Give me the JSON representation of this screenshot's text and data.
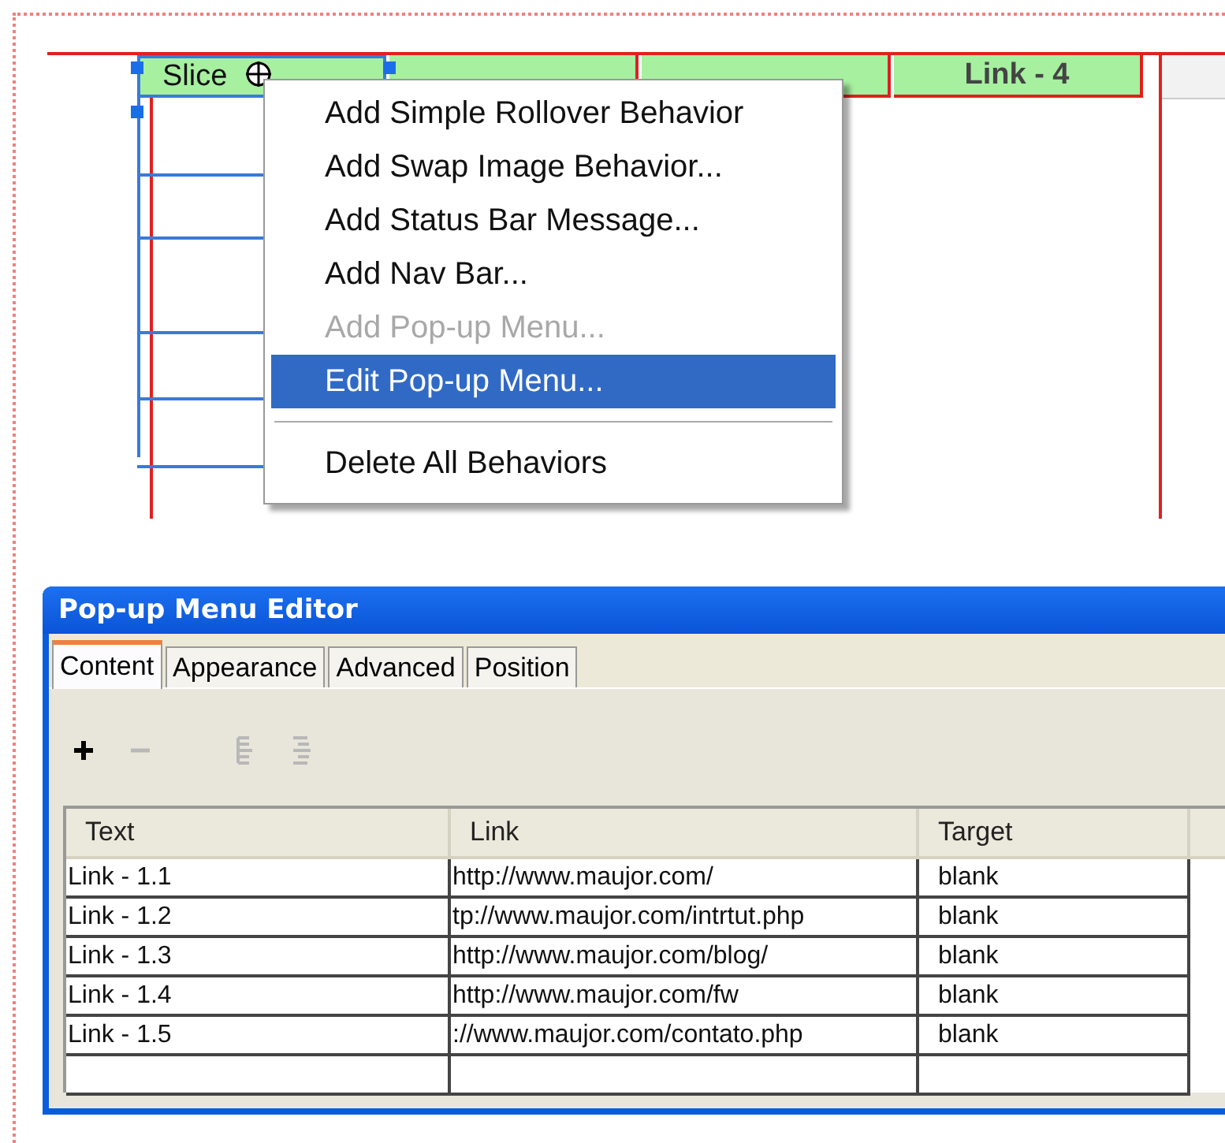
{
  "slice_table": {
    "cells": [
      {
        "label": "Slice",
        "selected": true
      },
      {
        "selected": false
      },
      {
        "selected": false
      },
      {
        "label": "Link - 4",
        "selected": false
      }
    ]
  },
  "context_menu": {
    "items": [
      {
        "kind": "item",
        "label": "Add Simple Rollover Behavior",
        "disabled": false,
        "selected": false
      },
      {
        "kind": "item",
        "label": "Add Swap Image Behavior...",
        "disabled": false,
        "selected": false
      },
      {
        "kind": "item",
        "label": "Add Status Bar Message...",
        "disabled": false,
        "selected": false
      },
      {
        "kind": "item",
        "label": "Add Nav Bar...",
        "disabled": false,
        "selected": false
      },
      {
        "kind": "item",
        "label": "Add Pop-up Menu...",
        "disabled": true,
        "selected": false
      },
      {
        "kind": "item",
        "label": "Edit Pop-up Menu...",
        "disabled": false,
        "selected": true
      },
      {
        "kind": "separator"
      },
      {
        "kind": "item",
        "label": "Delete All Behaviors",
        "disabled": false,
        "selected": false
      }
    ]
  },
  "dialog": {
    "title": "Pop-up Menu Editor",
    "tabs": [
      {
        "label": "Content",
        "selected": true
      },
      {
        "label": "Appearance",
        "selected": false
      },
      {
        "label": "Advanced",
        "selected": false
      },
      {
        "label": "Position",
        "selected": false
      }
    ],
    "toolbar": [
      {
        "kind": "add",
        "disabled": false
      },
      {
        "kind": "remove",
        "disabled": true
      },
      {
        "kind": "indent",
        "disabled": true
      },
      {
        "kind": "outdent",
        "disabled": true
      }
    ],
    "table": {
      "columns": [
        "Text",
        "Link",
        "Target"
      ],
      "rows": [
        [
          "Link - 1.1",
          "http://www.maujor.com/",
          "blank"
        ],
        [
          "Link - 1.2",
          "tp://www.maujor.com/intrtut.php",
          "blank"
        ],
        [
          "Link - 1.3",
          "http://www.maujor.com/blog/",
          "blank"
        ],
        [
          "Link - 1.4",
          "http://www.maujor.com/fw",
          "blank"
        ],
        [
          "Link - 1.5",
          "://www.maujor.com/contato.php",
          "blank"
        ]
      ]
    }
  }
}
